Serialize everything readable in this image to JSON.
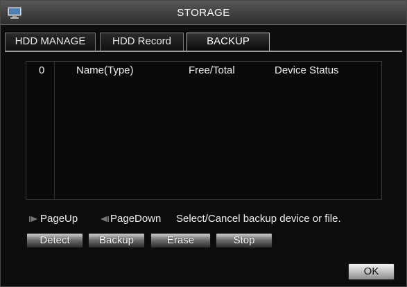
{
  "window": {
    "title": "STORAGE"
  },
  "tabs": [
    {
      "label": "HDD MANAGE",
      "active": false
    },
    {
      "label": "HDD Record",
      "active": false
    },
    {
      "label": "BACKUP",
      "active": true
    }
  ],
  "table": {
    "headers": [
      "0",
      "Name(Type)",
      "Free/Total",
      "Device Status"
    ],
    "rows": []
  },
  "pager": {
    "page_up": "PageUp",
    "page_down": "PageDown",
    "hint": "Select/Cancel backup device or file."
  },
  "buttons": {
    "detect": "Detect",
    "backup": "Backup",
    "erase": "Erase",
    "stop": "Stop",
    "ok": "OK"
  },
  "icons": {
    "title": "monitor-icon",
    "page_up": "page-up-icon",
    "page_down": "page-down-icon"
  }
}
